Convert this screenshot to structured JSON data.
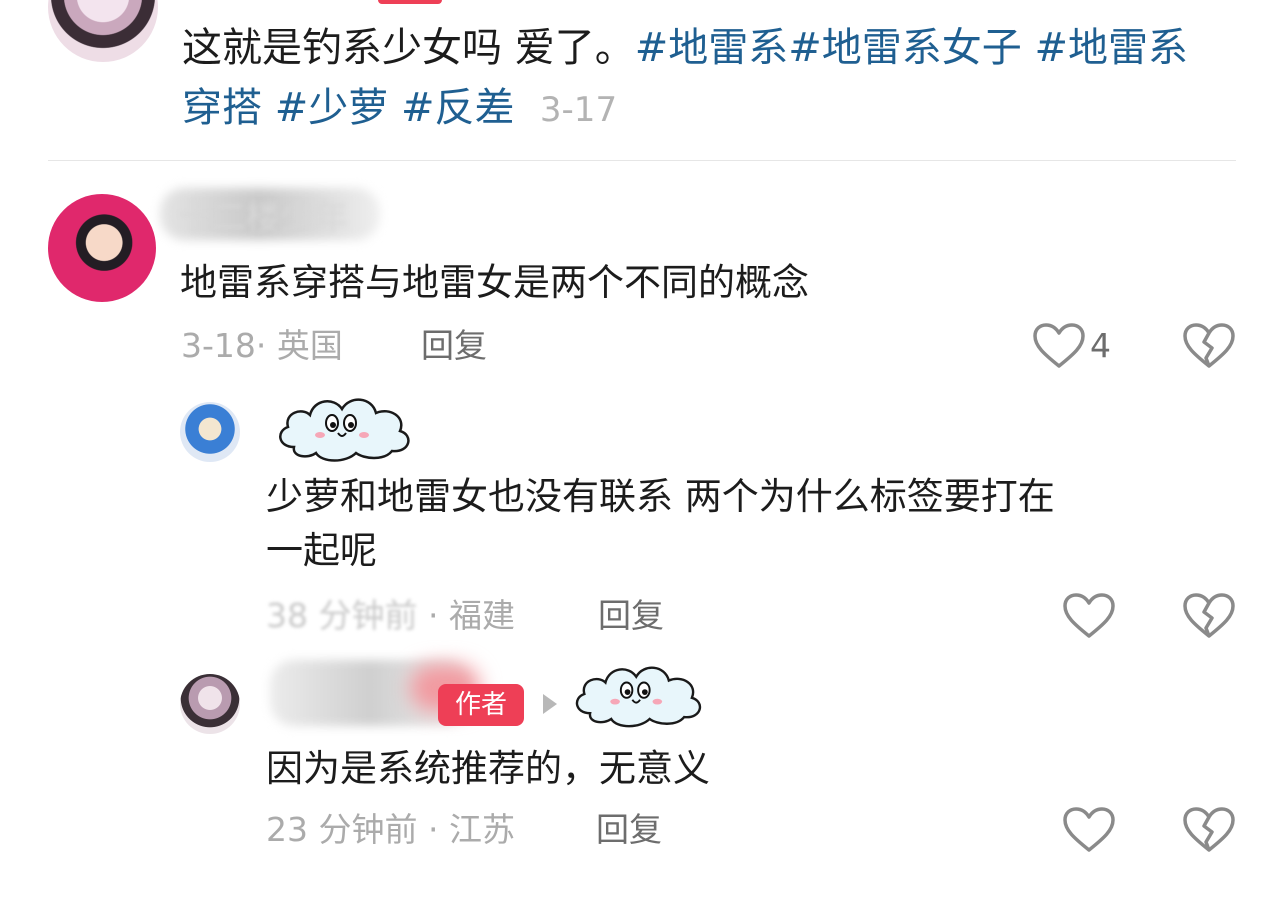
{
  "post": {
    "text_plain": "这就是钓系少女吗 爱了。",
    "tags": [
      "#地雷系",
      "#地雷系女子 ",
      "#地雷系穿搭 ",
      "#少萝 ",
      "#反差"
    ],
    "date": "3-17"
  },
  "comments": [
    {
      "username": "十二楼少年",
      "text": "地雷系穿搭与地雷女是两个不同的概念",
      "meta": "3-18· 英国",
      "reply_label": "回复",
      "like_count": "4"
    }
  ],
  "replies": [
    {
      "text_line1": "少萝和地雷女也没有联系 两个为什么标签要打在",
      "text_line2": "一起呢",
      "meta_time": "38 分钟前",
      "meta_sep": " · ",
      "meta_place": "福建",
      "reply_label": "回复"
    },
    {
      "author_badge": "作者",
      "text": "因为是系统推荐的，无意义",
      "meta": "23 分钟前 · 江苏",
      "reply_label": "回复"
    }
  ],
  "icons": {
    "like": "heart-outline-icon",
    "dislike": "broken-heart-icon",
    "sticker": "cloud-face-sticker"
  },
  "colors": {
    "tag": "#1f5f91",
    "meta": "#ababab",
    "author_badge": "#ee3f56"
  }
}
